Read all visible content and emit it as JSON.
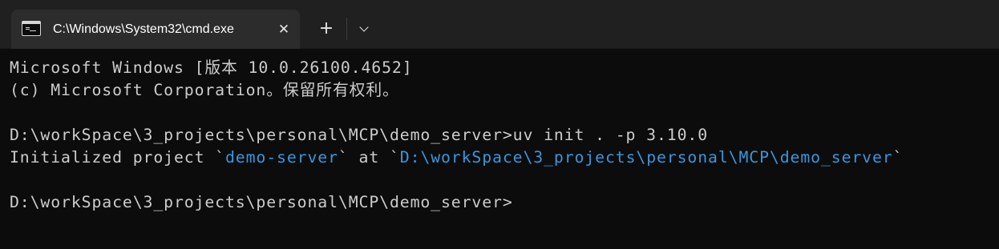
{
  "tab": {
    "icon": "terminal-icon",
    "title": "C:\\Windows\\System32\\cmd.exe",
    "close_icon": "close-icon",
    "new_tab_icon": "plus-icon",
    "dropdown_icon": "chevron-down-icon"
  },
  "console": {
    "line1": "Microsoft Windows [版本 10.0.26100.4652]",
    "line2": "(c) Microsoft Corporation。保留所有权利。",
    "line3": "",
    "line4": "D:\\workSpace\\3_projects\\personal\\MCP\\demo_server>uv init . -p 3.10.0",
    "line5": {
      "prefix": "Initialized project `",
      "project_name": "demo-server",
      "middle": "` at `",
      "path": "D:\\workSpace\\3_projects\\personal\\MCP\\demo_server",
      "suffix": "`"
    },
    "line6": "",
    "prompt": "D:\\workSpace\\3_projects\\personal\\MCP\\demo_server>"
  },
  "colors": {
    "background": "#0c0c0c",
    "text": "#cccccc",
    "highlight": "#3a96dd",
    "tabbar": "#202020",
    "active_tab": "#2c2c2c"
  }
}
